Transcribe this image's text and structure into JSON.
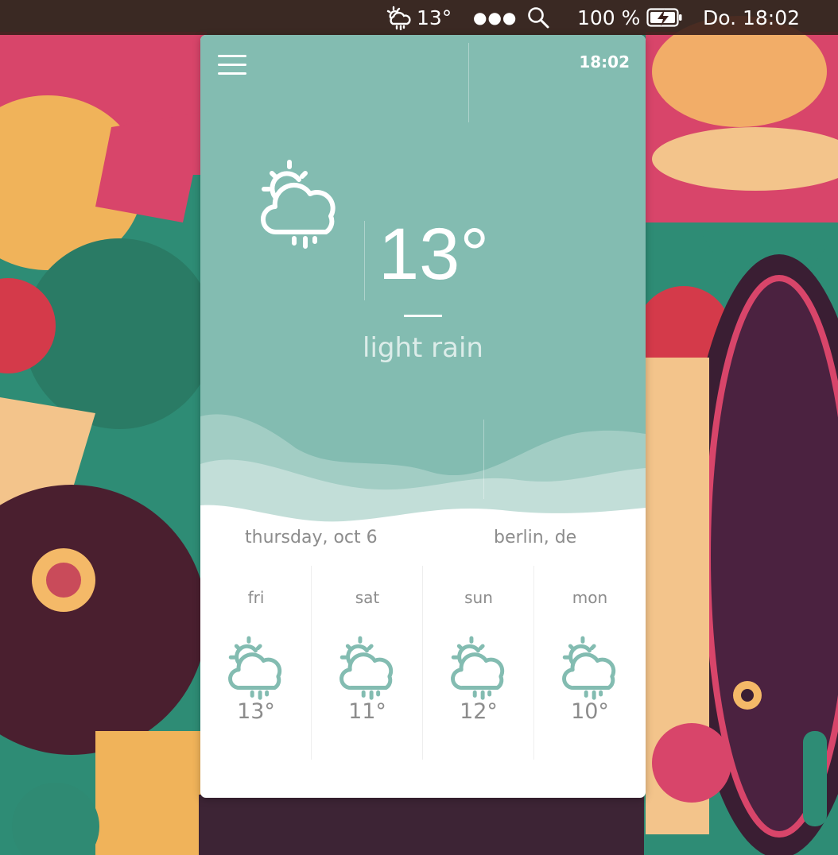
{
  "menubar": {
    "weather_icon": "cloud-sun-rain-icon",
    "weather_temp": "13°",
    "more_icon": "ellipsis-icon",
    "search_icon": "search-icon",
    "battery_percent": "100 %",
    "battery_icon": "battery-charging-icon",
    "clock": "Do. 18:02"
  },
  "widget": {
    "menu_icon": "hamburger-menu-icon",
    "time": "18:02",
    "current": {
      "icon": "cloud-sun-rain-icon",
      "temperature": "13°",
      "condition": "light rain"
    },
    "date": "thursday, oct 6",
    "location": "berlin, de",
    "forecast": [
      {
        "day": "fri",
        "temp": "13°",
        "icon": "cloud-sun-rain-icon"
      },
      {
        "day": "sat",
        "temp": "11°",
        "icon": "cloud-sun-rain-icon"
      },
      {
        "day": "sun",
        "temp": "12°",
        "icon": "cloud-sun-rain-icon"
      },
      {
        "day": "mon",
        "temp": "10°",
        "icon": "cloud-sun-rain-icon"
      }
    ]
  },
  "colors": {
    "accent_teal": "#83bcb1",
    "menubar_bg": "#3c211c",
    "muted_text": "#8c8c8c",
    "forecast_icon": "#83bcb1"
  }
}
